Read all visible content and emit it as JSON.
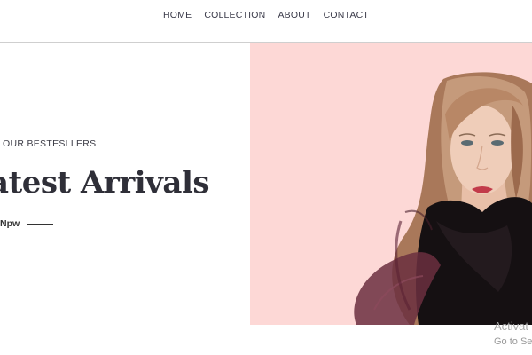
{
  "nav": {
    "items": [
      {
        "label": "HOME",
        "active": true
      },
      {
        "label": "COLLECTION",
        "active": false
      },
      {
        "label": "ABOUT",
        "active": false
      },
      {
        "label": "CONTACT",
        "active": false
      }
    ]
  },
  "hero": {
    "eyebrow": "OUR BESTESLLERS",
    "headline": "atest Arrivals",
    "cta_label": "Npw",
    "image_background": "#fdd8d6",
    "image_subject": "model-portrait"
  },
  "watermark": {
    "line1": "Activat",
    "line2": "Go to Set"
  }
}
